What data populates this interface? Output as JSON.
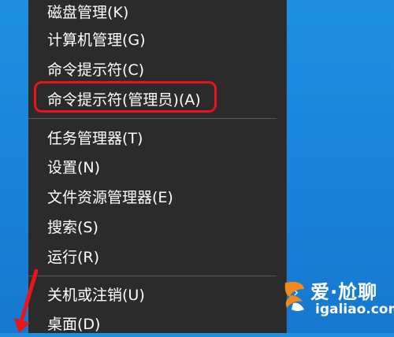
{
  "menu": {
    "items": [
      {
        "label": "磁盘管理(K)"
      },
      {
        "label": "计算机管理(G)"
      },
      {
        "label": "命令提示符(C)"
      },
      {
        "label": "命令提示符(管理员)(A)"
      },
      {
        "label": "任务管理器(T)"
      },
      {
        "label": "设置(N)"
      },
      {
        "label": "文件资源管理器(E)"
      },
      {
        "label": "搜索(S)"
      },
      {
        "label": "运行(R)"
      },
      {
        "label": "关机或注销(U)"
      },
      {
        "label": "桌面(D)"
      }
    ],
    "submenu_icon": "chevron-right-icon"
  },
  "watermark": {
    "title": "爱·尬聊",
    "subtitle": "igaliao.com"
  },
  "colors": {
    "menu_bg": "#2b2b2b",
    "highlight_border": "#e8151b",
    "desktop": "#1a86dc"
  }
}
